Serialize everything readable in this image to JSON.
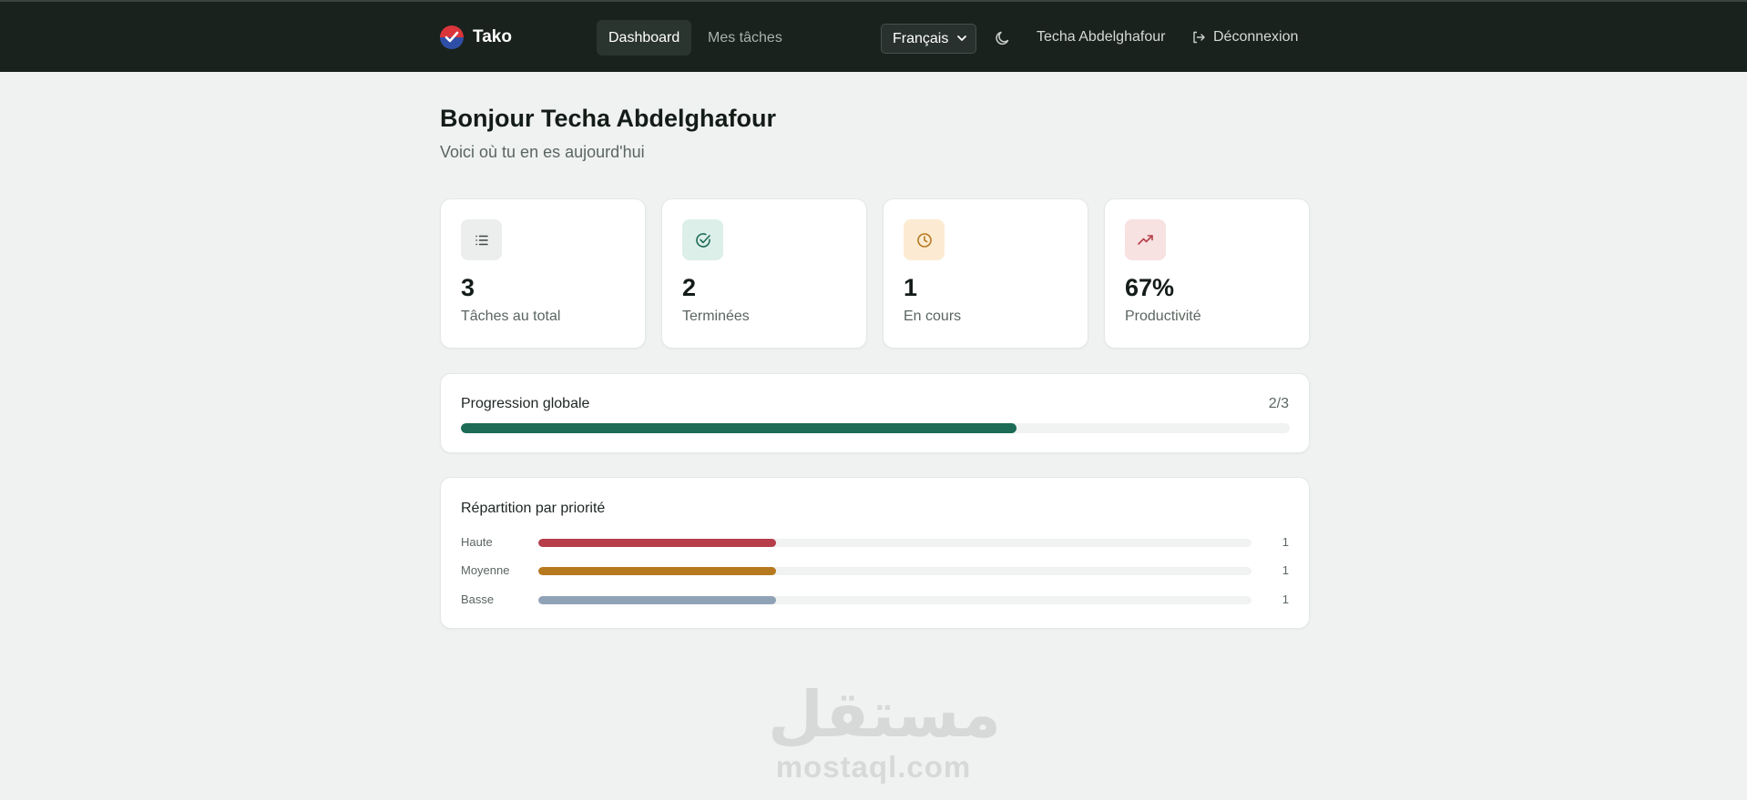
{
  "nav": {
    "brand": "Tako",
    "tabs": [
      {
        "label": "Dashboard",
        "active": true
      },
      {
        "label": "Mes tâches",
        "active": false
      }
    ],
    "language": "Français",
    "user": "Techa Abdelghafour",
    "logout": "Déconnexion"
  },
  "header": {
    "greeting": "Bonjour Techa Abdelghafour",
    "subtitle": "Voici où tu en es aujourd'hui"
  },
  "stats": [
    {
      "value": "3",
      "label": "Tâches au total",
      "icon": "list-icon",
      "bg": "#eceeed",
      "color": "#3c4742"
    },
    {
      "value": "2",
      "label": "Terminées",
      "icon": "check-circle-icon",
      "bg": "#dcefe9",
      "color": "#1e6b56"
    },
    {
      "value": "1",
      "label": "En cours",
      "icon": "clock-icon",
      "bg": "#fcebd2",
      "color": "#b7791f"
    },
    {
      "value": "67%",
      "label": "Productivité",
      "icon": "trending-up-icon",
      "bg": "#f8e1e1",
      "color": "#b4414b"
    }
  ],
  "progress": {
    "title": "Progression globale",
    "count": "2/3",
    "fraction": 0.67,
    "color": "#1c6b56"
  },
  "priority": {
    "title": "Répartition par priorité",
    "rows": [
      {
        "label": "Haute",
        "count": "1",
        "fraction": 0.333,
        "color": "#b53e4a"
      },
      {
        "label": "Moyenne",
        "count": "1",
        "fraction": 0.333,
        "color": "#b7791f"
      },
      {
        "label": "Basse",
        "count": "1",
        "fraction": 0.333,
        "color": "#90a2b6"
      }
    ]
  },
  "watermark": {
    "arabic": "مستقل",
    "latin": "mostaql.com"
  }
}
